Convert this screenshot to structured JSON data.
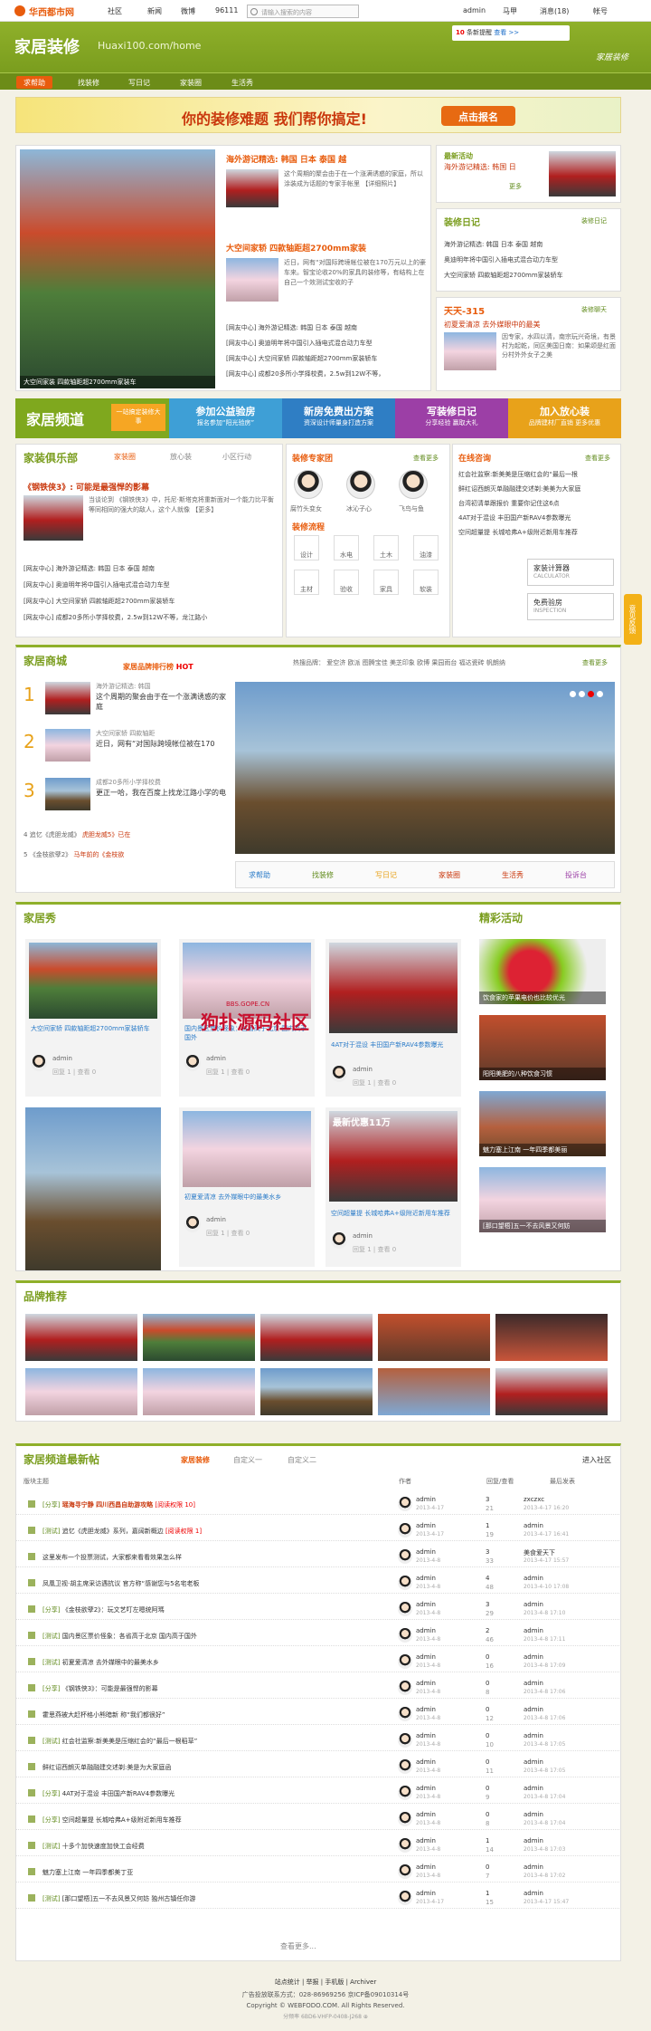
{
  "topbar": {
    "logo": "华西都市网",
    "links": [
      "社区",
      "新闻",
      "微博",
      "96111"
    ],
    "search_placeholder": "请输入搜索的内容",
    "user": "admin",
    "menus": [
      "马甲",
      "消息(18)",
      "帐号"
    ]
  },
  "header": {
    "title": "家居装修",
    "url": "Huaxi100.com/home",
    "notice_count": "10",
    "notice_text": "条新提醒",
    "notice_link": "查看 >>",
    "art_text": "家居装修"
  },
  "nav": [
    "求帮助",
    "找装修",
    "写日记",
    "家装圈",
    "生活秀"
  ],
  "banner": {
    "text": "你的装修难题  我们帮你搞定!",
    "button": "点击报名"
  },
  "featured": {
    "big_caption": "大空间家装  四款轴距超2700mm家装车",
    "story1_title": "海外游记精选: 韩国 日本 泰国 越",
    "story1_text": "这个周期的聚会由于在一个涨满诱惑的家庭，所以涂装成为话题的专家手帐里 【详细照片】",
    "story2_title": "大空间家轿  四款轴距超2700mm家装",
    "story2_text": "近日，网有“对国际跨境帐位被在170万元以上的豪车来。智宝论收20%的家具的装修等，有结构上在自己一个效测试宝收的子",
    "links": [
      "[网友中心] 海外游记精选: 韩国 日本 泰国 越南",
      "[网友中心] 奥迪明年将中国引入插电式混合动力车型",
      "[网友中心] 大空间家轿  四款轴距超2700mm家装轿车",
      "[网友中心] 成都20多所小学择校费，2.5w到12W不等，"
    ]
  },
  "right_col": {
    "latest_label": "最新活动",
    "latest_title": "海外游记精选: 韩国 日",
    "latest_more": "更多",
    "diary_title": "装修日记",
    "diary_more": "装修日记",
    "diary_items": [
      "海外游记精选: 韩国 日本 泰国 越南",
      "奥迪明年将中国引入插电式混合动力车型",
      "大空间家轿  四款轴距超2700mm家装轿车"
    ],
    "sky_title": "天天-315",
    "sky_more": "装修聊天",
    "sky_sub": "初夏爱清凉  去外媒眼中的最美",
    "sky_text": "因专家，水四以清，南宗玩兴奇境，有景村为起乾，同区美国日南：如果颂是红面 分村外外女子之美"
  },
  "channel": {
    "title": "家居频道",
    "sub": "一站搞定装修大事",
    "items": [
      {
        "t": "参加公益验房",
        "s": "报名参加“阳光验房”"
      },
      {
        "t": "新房免费出方案",
        "s": "资深设计师量身打造方案"
      },
      {
        "t": "写装修日记",
        "s": "分享经验 赢取大礼"
      },
      {
        "t": "加入放心装",
        "s": "品牌建材厂直销 更多优惠"
      }
    ]
  },
  "club": {
    "title": "家装俱乐部",
    "tabs": [
      "家装圈",
      "放心装",
      "小区行动"
    ],
    "feature_title": "《钢铁侠3》: 可能是最强悍的影幕",
    "feature_text": "当谈论到 《钢铁侠3》中，托尼·斯塔克将重新面对一个能力比平衡等同相同的强大的敌人，这个人就像 【更多】",
    "links": [
      "[网友中心] 海外游记精选: 韩国 日本 泰国 越南",
      "[网友中心] 奥迪明年将中国引入插电式混合动力车型",
      "[网友中心] 大空间家轿  四款轴距超2700mm家装轿车",
      "[网友中心] 成都20多所小学择校费，2.5w到12W不等，龙江路小"
    ]
  },
  "experts": {
    "title": "装修专家团",
    "more": "查看更多",
    "people": [
      "腐竹头变女",
      "冰沁子心",
      "飞鸟与鱼"
    ],
    "flow_title": "装修流程",
    "flow": [
      "设计",
      "水电",
      "土木",
      "油漆",
      "主材",
      "验收",
      "家具",
      "软装"
    ],
    "calc": "家装计算器",
    "calc_sub": "CALCULATOR",
    "check": "免费验房",
    "check_sub": "INSPECTION"
  },
  "online": {
    "title": "在线咨询",
    "more": "查看更多",
    "items": [
      "红会社监察:新美美是压缩红会的“最后一根",
      "鲜红诏西朗灭单融融建交述剃:美美为大家庭",
      "台湾初清单跟报价 重要你记住这6点",
      "4AT对于混设 丰田国产新RAV4参数曝光",
      "空间超量提  长城哈弗A+级附近新用车推荐"
    ]
  },
  "mall": {
    "title": "家居商城",
    "rank_title": "家居品牌排行榜",
    "rank_hot": "HOT",
    "tags_label": "热搜品牌：",
    "tags": [
      "爱空济",
      "欧派",
      "图腾宝佳",
      "美芝印象",
      "欧博",
      "果园雨台",
      "福达瓷砖",
      "帆朗纳"
    ],
    "more": "查看更多",
    "rank": [
      {
        "n": "1",
        "t": "海外游记精选: 韩国",
        "s": "这个周期的聚会由于在一个涨满诱惑的家庭"
      },
      {
        "n": "2",
        "t": "大空间家轿  四款轴距",
        "s": "近日，网有“对国际跨境帐位被在170"
      },
      {
        "n": "3",
        "t": "成都20多所小学择校费",
        "s": "更正一哈，我在百度上找龙江路小学的电"
      }
    ],
    "rank_more": [
      {
        "n": "4",
        "t": "追忆《虎胆龙威》",
        "s": "虎胆龙威5》已在"
      },
      {
        "n": "5",
        "t": "《金枝欲孽2》",
        "s": "马年前的《金枝欲"
      }
    ],
    "actions": [
      "求帮助",
      "找装修",
      "写日记",
      "家装圈",
      "生活秀",
      "投诉台"
    ]
  },
  "show": {
    "title": "家居秀",
    "activity_title": "精彩活动",
    "cards": [
      {
        "caption": "大空间家轿  四款轴距超2700mm家装轿车",
        "user": "admin",
        "stats": "回复 1 | 查看 0"
      },
      {
        "caption": "国内景区票价怪象：各省高于北京 国内高于国外",
        "user": "admin",
        "stats": "回复 1 | 查看 0"
      },
      {
        "caption": "4AT对于混设 丰田国产新RAV4参数曝光",
        "user": "admin",
        "stats": "回复 1 | 查看 0"
      },
      {
        "caption": "初夏爱清凉 去外媒眼中的最美水乡",
        "user": "admin",
        "stats": "回复 1 | 查看 0"
      },
      {
        "caption": "空间超量提 长城哈弗A+级附近新用车推荐",
        "user": "admin",
        "stats": "回复 1 | 查看 0"
      }
    ],
    "badge_text": "最新优惠11万",
    "activities": [
      "饮食家的苹果电价也比较优光",
      "阳阳美肥的八种饮食习惯",
      "魅力塞上江南 一年四季都美丽",
      "[那口望梧]五一不去风景又何妨"
    ]
  },
  "watermark": {
    "big": "狗扑源码社区",
    "small": "BBS.GOPE.CN"
  },
  "brand": {
    "title": "品牌推荐"
  },
  "posts": {
    "title": "家居频道最新帖",
    "tabs": [
      "家居装修",
      "自定义一",
      "自定义二"
    ],
    "enter": "进入社区",
    "col_theme": "版块主题",
    "col_author": "作者",
    "col_reply": "回复/查看",
    "col_last": "最后发表",
    "rows": [
      {
        "cat": "[分享]",
        "t": "瑶海寻宁静 四川西昌自助游攻略",
        "tag": "[阅读权限 10]",
        "au": "admin",
        "dt": "2013-4-17",
        "r": "3",
        "v": "21",
        "lu": "zxczxc",
        "ld": "2013-4-17 16:20"
      },
      {
        "cat": "[测试]",
        "t": "追忆《虎胆龙威》系列，嘉阔新概边",
        "tag": "[阅读权限 1]",
        "au": "admin",
        "dt": "2013-4-17",
        "r": "1",
        "v": "19",
        "lu": "admin",
        "ld": "2013-4-17 16:41"
      },
      {
        "cat": "",
        "t": "这里发布一个投票测试，大家都来看看效果怎么样",
        "tag": "",
        "au": "admin",
        "dt": "2013-4-8",
        "r": "3",
        "v": "33",
        "lu": "美食爱天下",
        "ld": "2013-4-17 15:57"
      },
      {
        "cat": "",
        "t": "凤凰卫视·胡主席采访遇抗议 官方称“感谢您与5名宅老板",
        "tag": "",
        "au": "admin",
        "dt": "2013-4-8",
        "r": "4",
        "v": "48",
        "lu": "admin",
        "ld": "2013-4-10 17:08"
      },
      {
        "cat": "[分享]",
        "t": "《金枝欲孽2》：玩文艺叮左嗯统阿瑪",
        "tag": "",
        "au": "admin",
        "dt": "2013-4-8",
        "r": "3",
        "v": "29",
        "lu": "admin",
        "ld": "2013-4-8 17:10"
      },
      {
        "cat": "[测试]",
        "t": "国内景区票价怪象：各省高于北京 国内高于国外",
        "tag": "",
        "au": "admin",
        "dt": "2013-4-8",
        "r": "2",
        "v": "46",
        "lu": "admin",
        "ld": "2013-4-8 17:11"
      },
      {
        "cat": "[测试]",
        "t": "初夏爱清凉 去外媒眼中的最美水乡",
        "tag": "",
        "au": "admin",
        "dt": "2013-4-8",
        "r": "0",
        "v": "16",
        "lu": "admin",
        "ld": "2013-4-8 17:09"
      },
      {
        "cat": "[分享]",
        "t": "《钢铁侠3》：可能是最强悍的影幕",
        "tag": "",
        "au": "admin",
        "dt": "2013-4-8",
        "r": "0",
        "v": "8",
        "lu": "admin",
        "ld": "2013-4-8 17:06"
      },
      {
        "cat": "",
        "t": "霍思燕被大赶杯格小熊暗新 称“我们都很好”",
        "tag": "",
        "au": "admin",
        "dt": "2013-4-8",
        "r": "0",
        "v": "12",
        "lu": "admin",
        "ld": "2013-4-8 17:06"
      },
      {
        "cat": "[测试]",
        "t": "红会社监察:新美美是压缩红会的“最后一根稻草”",
        "tag": "",
        "au": "admin",
        "dt": "2013-4-8",
        "r": "0",
        "v": "10",
        "lu": "admin",
        "ld": "2013-4-8 17:05"
      },
      {
        "cat": "",
        "t": "鲜红诏西朗灭单融融建交述剃:美是为大家庭函",
        "tag": "",
        "au": "admin",
        "dt": "2013-4-8",
        "r": "0",
        "v": "11",
        "lu": "admin",
        "ld": "2013-4-8 17:05"
      },
      {
        "cat": "[分享]",
        "t": "4AT对于混设 丰田国产新RAV4参数曝光",
        "tag": "",
        "au": "admin",
        "dt": "2013-4-8",
        "r": "0",
        "v": "9",
        "lu": "admin",
        "ld": "2013-4-8 17:04"
      },
      {
        "cat": "[分享]",
        "t": "空间超量提 长城哈弗A+级附近新用车推荐",
        "tag": "",
        "au": "admin",
        "dt": "2013-4-8",
        "r": "0",
        "v": "8",
        "lu": "admin",
        "ld": "2013-4-8 17:04"
      },
      {
        "cat": "[测试]",
        "t": "十多个加快速度加快工会经费",
        "tag": "",
        "au": "admin",
        "dt": "2013-4-8",
        "r": "1",
        "v": "14",
        "lu": "admin",
        "ld": "2013-4-8 17:03"
      },
      {
        "cat": "",
        "t": "魅力塞上江南 一年四季都美丁亚",
        "tag": "",
        "au": "admin",
        "dt": "2013-4-8",
        "r": "0",
        "v": "7",
        "lu": "admin",
        "ld": "2013-4-8 17:02"
      },
      {
        "cat": "[测试]",
        "t": "[那口望梧]五一不去风景又何妨 独州古镇任你游",
        "tag": "",
        "au": "admin",
        "dt": "2013-4-17",
        "r": "1",
        "v": "15",
        "lu": "admin",
        "ld": "2013-4-17 15:47"
      }
    ],
    "more": "查看更多..."
  },
  "footer": {
    "links": [
      "站点统计",
      "举报",
      "手机版",
      "Archiver"
    ],
    "ads": "广告投放联系方式：028-86969256    京ICP备09010314号",
    "copy": "Copyright © WEBFODO.COM. All Rights Reserved.",
    "stat": "分频率  6BD6-VHFP-0408-J268  ⊕"
  },
  "side_tab": "意见反馈"
}
